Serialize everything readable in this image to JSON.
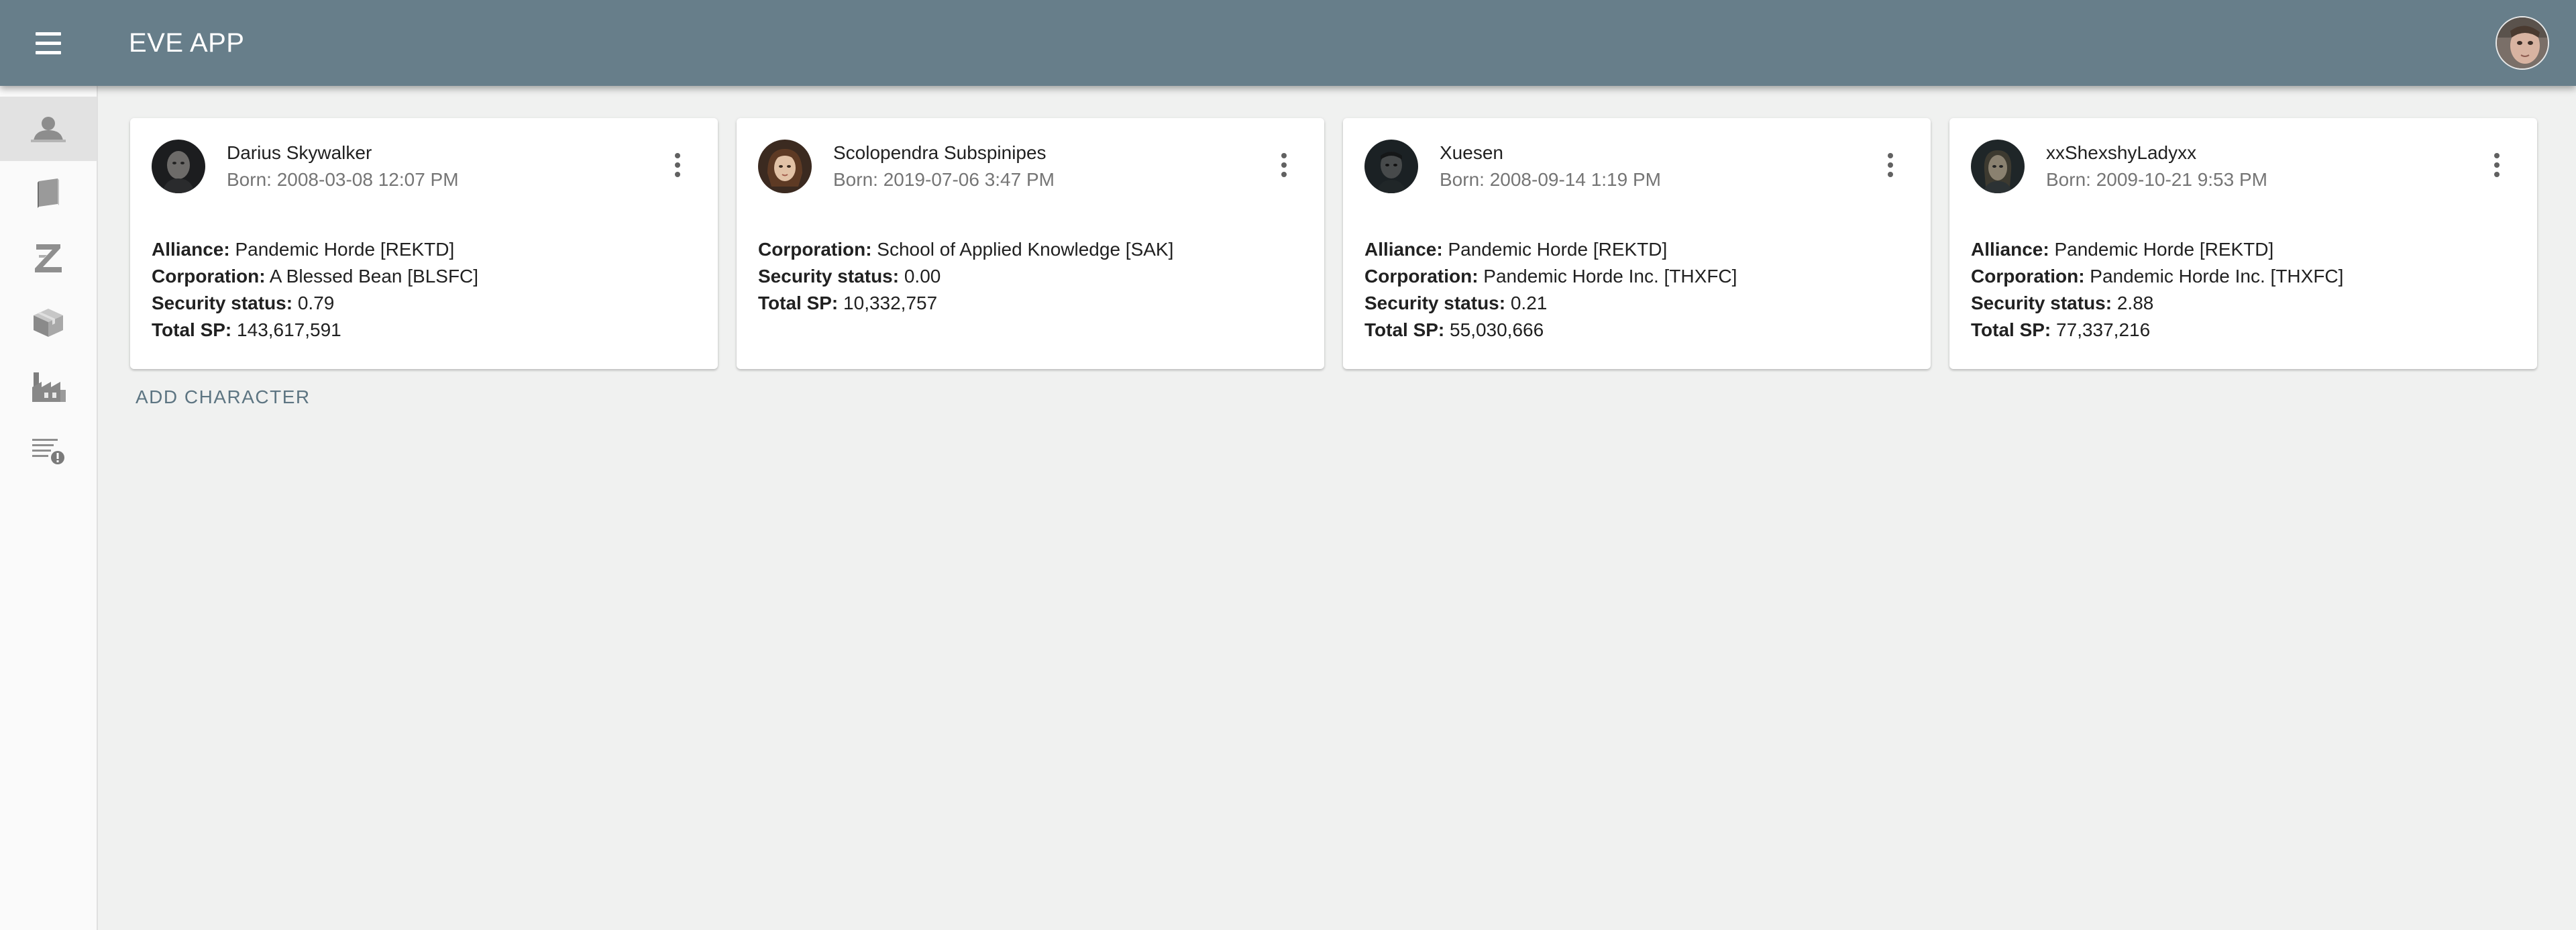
{
  "app": {
    "title": "EVE APP"
  },
  "header": {
    "menu_icon": "hamburger-icon",
    "avatar_icon": "user-avatar"
  },
  "sidebar": {
    "items": [
      {
        "icon": "character-icon",
        "active": true
      },
      {
        "icon": "book-icon",
        "active": false
      },
      {
        "icon": "z-icon",
        "active": false
      },
      {
        "icon": "cargo-box-icon",
        "active": false
      },
      {
        "icon": "industry-factory-icon",
        "active": false
      },
      {
        "icon": "list-alert-icon",
        "active": false
      }
    ]
  },
  "characters": [
    {
      "name": "Darius Skywalker",
      "born": "Born: 2008-03-08 12:07 PM",
      "fields": [
        {
          "label": "Alliance:",
          "value": " Pandemic Horde [REKTD]"
        },
        {
          "label": "Corporation:",
          "value": " A Blessed Bean [BLSFC]"
        },
        {
          "label": "Security status:",
          "value": " 0.79"
        },
        {
          "label": "Total SP:",
          "value": " 143,617,591"
        }
      ]
    },
    {
      "name": "Scolopendra Subspinipes",
      "born": "Born: 2019-07-06 3:47 PM",
      "fields": [
        {
          "label": "Corporation:",
          "value": " School of Applied Knowledge [SAK]"
        },
        {
          "label": "Security status:",
          "value": " 0.00"
        },
        {
          "label": "Total SP:",
          "value": " 10,332,757"
        }
      ]
    },
    {
      "name": "Xuesen",
      "born": "Born: 2008-09-14 1:19 PM",
      "fields": [
        {
          "label": "Alliance:",
          "value": " Pandemic Horde [REKTD]"
        },
        {
          "label": "Corporation:",
          "value": " Pandemic Horde Inc. [THXFC]"
        },
        {
          "label": "Security status:",
          "value": " 0.21"
        },
        {
          "label": "Total SP:",
          "value": " 55,030,666"
        }
      ]
    },
    {
      "name": "xxShexshyLadyxx",
      "born": "Born: 2009-10-21 9:53 PM",
      "fields": [
        {
          "label": "Alliance:",
          "value": " Pandemic Horde [REKTD]"
        },
        {
          "label": "Corporation:",
          "value": " Pandemic Horde Inc. [THXFC]"
        },
        {
          "label": "Security status:",
          "value": " 2.88"
        },
        {
          "label": "Total SP:",
          "value": " 77,337,216"
        }
      ]
    }
  ],
  "actions": {
    "add_character": "ADD CHARACTER"
  },
  "colors": {
    "appbar": "#677e8a",
    "accent": "#5d7582",
    "background": "#f0f1f0"
  }
}
